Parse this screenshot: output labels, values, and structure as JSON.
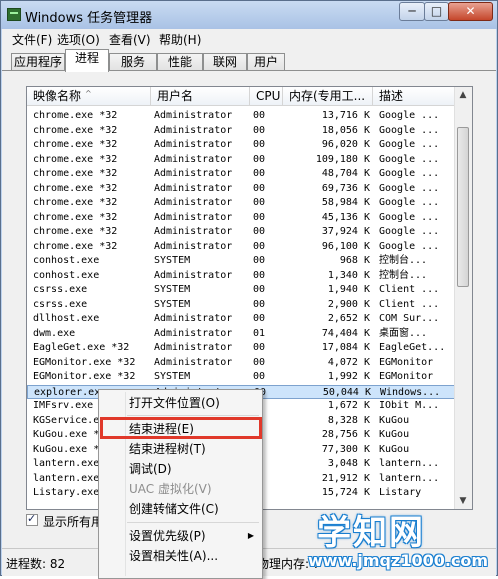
{
  "window": {
    "title": "Windows 任务管理器",
    "controls": {
      "minimize": "─",
      "maximize": "□",
      "close": "✕"
    }
  },
  "menubar": [
    "文件(F)",
    "选项(O)",
    "查看(V)",
    "帮助(H)"
  ],
  "tabs": [
    "应用程序",
    "进程",
    "服务",
    "性能",
    "联网",
    "用户"
  ],
  "active_tab": "进程",
  "columns": {
    "name": "映像名称",
    "user": "用户名",
    "cpu": "CPU",
    "mem": "内存(专用工...",
    "desc": "描述"
  },
  "sort_indicator": "^",
  "processes": [
    {
      "name": "chrome.exe *32",
      "user": "Administrator",
      "cpu": "00",
      "mem": "13,716 K",
      "desc": "Google ..."
    },
    {
      "name": "chrome.exe *32",
      "user": "Administrator",
      "cpu": "00",
      "mem": "18,056 K",
      "desc": "Google ..."
    },
    {
      "name": "chrome.exe *32",
      "user": "Administrator",
      "cpu": "00",
      "mem": "96,020 K",
      "desc": "Google ..."
    },
    {
      "name": "chrome.exe *32",
      "user": "Administrator",
      "cpu": "00",
      "mem": "109,180 K",
      "desc": "Google ..."
    },
    {
      "name": "chrome.exe *32",
      "user": "Administrator",
      "cpu": "00",
      "mem": "48,704 K",
      "desc": "Google ..."
    },
    {
      "name": "chrome.exe *32",
      "user": "Administrator",
      "cpu": "00",
      "mem": "69,736 K",
      "desc": "Google ..."
    },
    {
      "name": "chrome.exe *32",
      "user": "Administrator",
      "cpu": "00",
      "mem": "58,984 K",
      "desc": "Google ..."
    },
    {
      "name": "chrome.exe *32",
      "user": "Administrator",
      "cpu": "00",
      "mem": "45,136 K",
      "desc": "Google ..."
    },
    {
      "name": "chrome.exe *32",
      "user": "Administrator",
      "cpu": "00",
      "mem": "37,924 K",
      "desc": "Google ..."
    },
    {
      "name": "chrome.exe *32",
      "user": "Administrator",
      "cpu": "00",
      "mem": "96,100 K",
      "desc": "Google ..."
    },
    {
      "name": "conhost.exe",
      "user": "SYSTEM",
      "cpu": "00",
      "mem": "968 K",
      "desc": "控制台..."
    },
    {
      "name": "conhost.exe",
      "user": "Administrator",
      "cpu": "00",
      "mem": "1,340 K",
      "desc": "控制台..."
    },
    {
      "name": "csrss.exe",
      "user": "SYSTEM",
      "cpu": "00",
      "mem": "1,940 K",
      "desc": "Client ..."
    },
    {
      "name": "csrss.exe",
      "user": "SYSTEM",
      "cpu": "00",
      "mem": "2,900 K",
      "desc": "Client ..."
    },
    {
      "name": "dllhost.exe",
      "user": "Administrator",
      "cpu": "00",
      "mem": "2,652 K",
      "desc": "COM Sur..."
    },
    {
      "name": "dwm.exe",
      "user": "Administrator",
      "cpu": "01",
      "mem": "74,404 K",
      "desc": "桌面窗..."
    },
    {
      "name": "EagleGet.exe *32",
      "user": "Administrator",
      "cpu": "00",
      "mem": "17,084 K",
      "desc": "EagleGet..."
    },
    {
      "name": "EGMonitor.exe *32",
      "user": "Administrator",
      "cpu": "00",
      "mem": "4,072 K",
      "desc": "EGMonitor"
    },
    {
      "name": "EGMonitor.exe *32",
      "user": "SYSTEM",
      "cpu": "00",
      "mem": "1,992 K",
      "desc": "EGMonitor"
    },
    {
      "name": "explorer.exe",
      "user": "Administrator",
      "cpu": "00",
      "mem": "50,044 K",
      "desc": "Windows..."
    },
    {
      "name": "IMFsrv.exe *",
      "user": "",
      "cpu": "",
      "mem": "1,672 K",
      "desc": "IObit M..."
    },
    {
      "name": "KGService.e",
      "user": "",
      "cpu": "",
      "mem": "8,328 K",
      "desc": "KuGou"
    },
    {
      "name": "KuGou.exe *3",
      "user": "",
      "cpu": "",
      "mem": "28,756 K",
      "desc": "KuGou"
    },
    {
      "name": "KuGou.exe *3",
      "user": "",
      "cpu": "",
      "mem": "77,300 K",
      "desc": "KuGou"
    },
    {
      "name": "lantern.exe",
      "user": "",
      "cpu": "",
      "mem": "3,048 K",
      "desc": "lantern..."
    },
    {
      "name": "lantern.exe",
      "user": "",
      "cpu": "",
      "mem": "21,912 K",
      "desc": "lantern..."
    },
    {
      "name": "Listary.exe",
      "user": "",
      "cpu": "",
      "mem": "15,724 K",
      "desc": "Listary"
    }
  ],
  "show_all_label": "显示所有用户的进程(S)",
  "status": {
    "processes": "进程数: 82",
    "right": "物理内存: 7"
  },
  "context_menu": [
    {
      "label": "打开文件位置(O)",
      "disabled": false,
      "submenu": false
    },
    {
      "label": "结束进程(E)",
      "disabled": false,
      "submenu": false
    },
    {
      "label": "结束进程树(T)",
      "disabled": false,
      "submenu": false
    },
    {
      "label": "调试(D)",
      "disabled": false,
      "submenu": false
    },
    {
      "label": "UAC 虚拟化(V)",
      "disabled": true,
      "submenu": false
    },
    {
      "label": "创建转储文件(C)",
      "disabled": false,
      "submenu": false
    },
    {
      "label": "设置优先级(P)",
      "disabled": false,
      "submenu": true
    },
    {
      "label": "设置相关性(A)...",
      "disabled": false,
      "submenu": false
    }
  ],
  "watermark": {
    "title": "学知网",
    "url": "www.jmqz1000.com"
  },
  "colors": {
    "highlight": "#e0382a",
    "selection": "#cde4fb",
    "watermark_outline": "#1a7fd0"
  }
}
